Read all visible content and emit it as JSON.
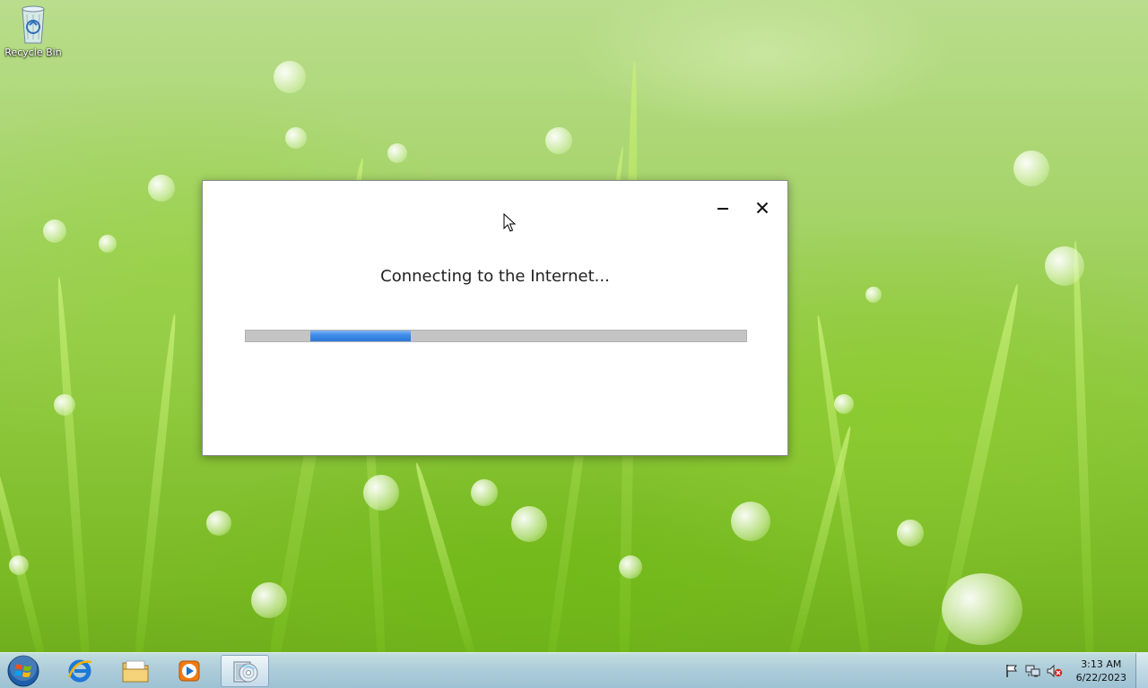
{
  "desktop": {
    "icons": [
      {
        "label": "Recycle Bin",
        "icon": "recycle-bin-icon"
      }
    ]
  },
  "dialog": {
    "status_text": "Connecting to the Internet...",
    "minimize_icon": "minimize-icon",
    "close_icon": "close-icon",
    "progress": {
      "indeterminate": true,
      "fill_color": "#3d8ae8",
      "track_color": "#c4c4c4"
    }
  },
  "taskbar": {
    "start_icon": "windows-start-icon",
    "pinned": [
      {
        "name": "internet-explorer",
        "icon": "internet-explorer-icon"
      },
      {
        "name": "windows-explorer",
        "icon": "folder-icon"
      },
      {
        "name": "windows-media-player",
        "icon": "media-player-icon"
      },
      {
        "name": "setup-program",
        "icon": "setup-disc-icon",
        "active": true
      }
    ],
    "tray": {
      "icons": [
        "action-center-flag-icon",
        "network-icon",
        "volume-muted-icon"
      ],
      "time": "3:13 AM",
      "date": "6/22/2023"
    }
  },
  "colors": {
    "accent": "#3d8ae8",
    "taskbar": "#b4d0e6"
  }
}
